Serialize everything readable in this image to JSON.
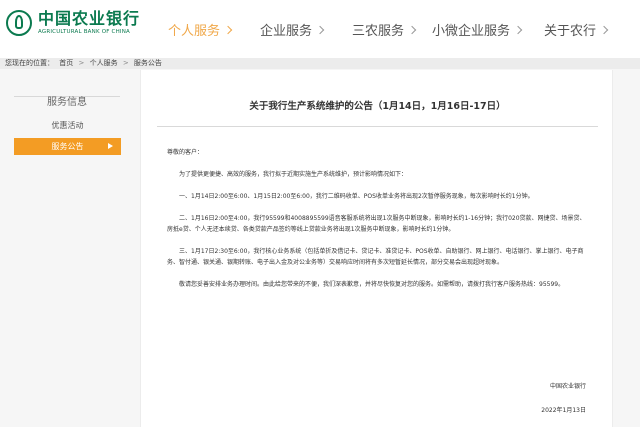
{
  "header": {
    "logo_cn": "中国农业银行",
    "logo_en": "AGRICULTURAL BANK OF CHINA",
    "nav": [
      {
        "label": "个人服务"
      },
      {
        "label": "企业服务"
      },
      {
        "label": "三农服务"
      },
      {
        "label": "小微企业服务"
      },
      {
        "label": "关于农行"
      }
    ],
    "active_nav_color": "#f0a84a"
  },
  "breadcrumb": {
    "prefix": "您现在的位置：",
    "items": [
      "首页",
      "个人服务",
      "服务公告"
    ],
    "separator": ">"
  },
  "sidebar": {
    "title": "服务信息",
    "items": [
      {
        "label": "优惠活动"
      },
      {
        "label": "服务公告"
      }
    ],
    "active_color": "#f39c24"
  },
  "notice": {
    "title": "关于我行生产系统维护的公告（1月14日，1月16日-17日）",
    "greeting": "尊敬的客户：",
    "intro": "为了提供更便捷、高效的服务，我行拟于近期实施生产系统维护，预计影响情况如下：",
    "items": [
      "一、1月14日2:00至6:00、1月15日2:00至6:00，我行二维码收单、POS收单业务将出现2次暂停服务现象，每次影响时长约1分钟。",
      "二、1月16日2:00至4:00，我行95599和4008895599语音客服系统将出现1次服务中断现象，影响时长约1-16分钟；我行020贷款、网捷贷、场景贷、房抵e贷、个人无还本续贷、各类贷款产品签约等线上贷款业务将出现1次服务中断现象，影响时长约1分钟。",
      "三、1月17日2:30至6:00，我行核心业务系统（包括单折及借记卡、贷记卡、准贷记卡、POS收单、自助银行、网上银行、电话银行、掌上银行、电子商务、智付通、银关通、银期转账、电子出入金及对公业务等）交易响应时间将有多次短暂延长情况，部分交易会出现超时现象。"
    ],
    "closing": "敬请您妥善安排业务办理时间。由此给您带来的不便，我们深表歉意，并将尽快恢复对您的服务。如需帮助，请拨打我行客户服务热线：95599。",
    "signature_org": "中国农业银行",
    "signature_date": "2022年1月13日"
  }
}
